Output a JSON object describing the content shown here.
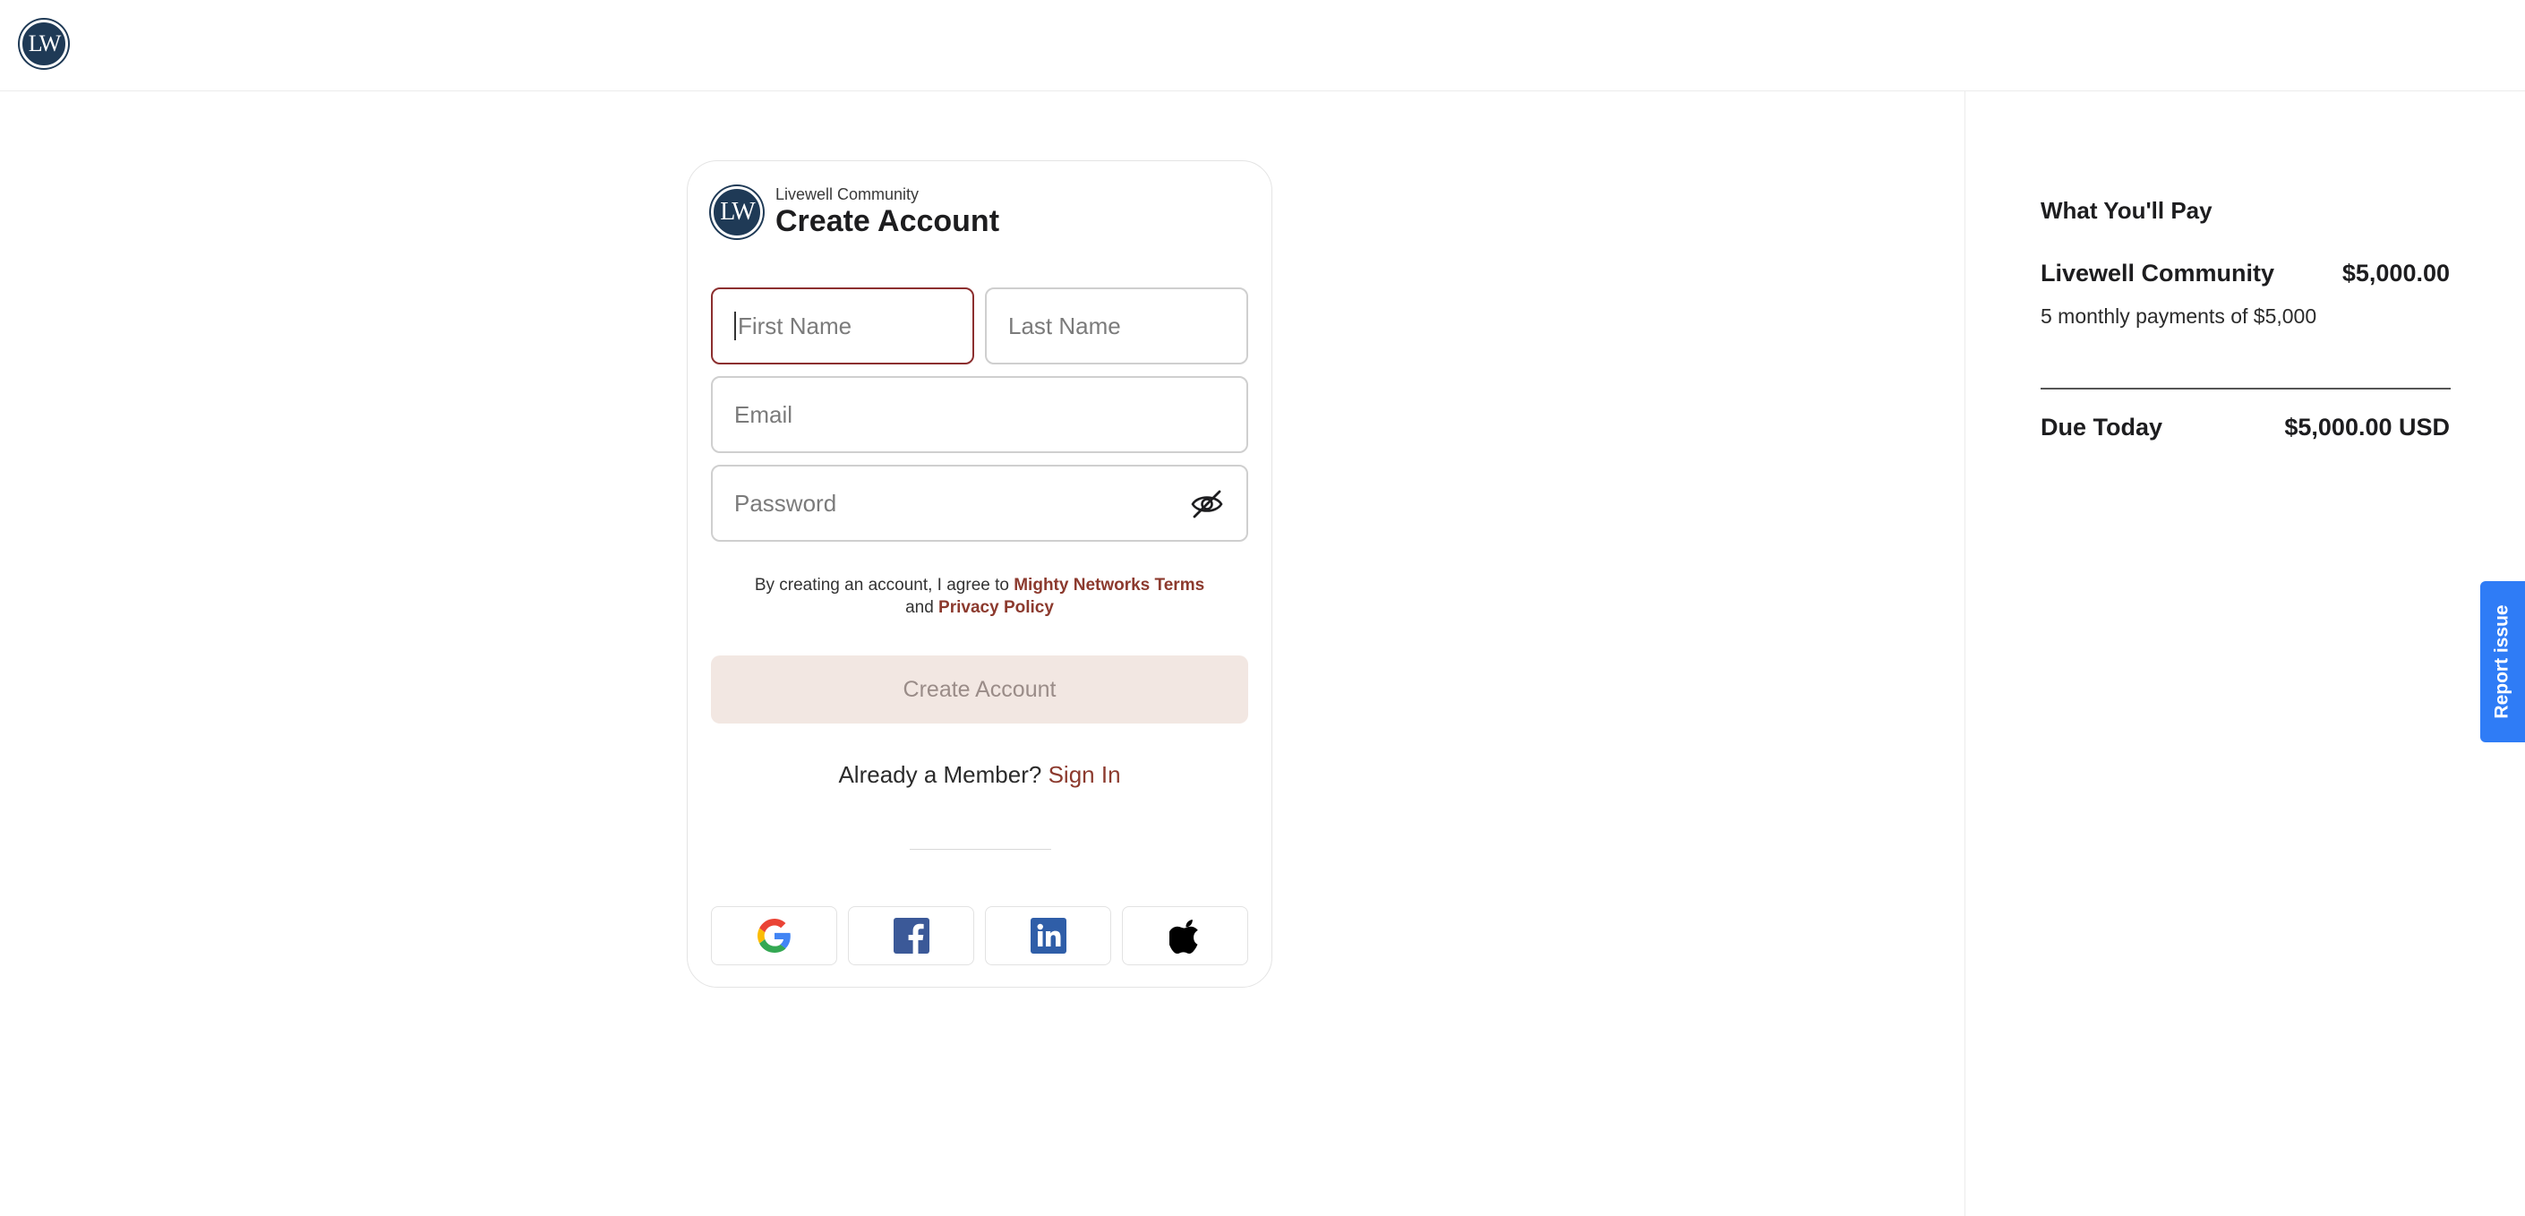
{
  "header": {
    "logo_text": "LW"
  },
  "signup": {
    "logo_text": "LW",
    "community_name": "Livewell Community",
    "title": "Create Account",
    "fields": {
      "first_name_placeholder": "First Name",
      "last_name_placeholder": "Last Name",
      "email_placeholder": "Email",
      "password_placeholder": "Password"
    },
    "terms": {
      "prefix": "By creating an account, I agree to",
      "terms_link": "Mighty Networks Terms",
      "conjunction": "and",
      "privacy_link": "Privacy Policy"
    },
    "submit_label": "Create Account",
    "member_prompt": "Already a Member?",
    "sign_in_label": "Sign In",
    "social_buttons": [
      "google-icon",
      "facebook-icon",
      "linkedin-icon",
      "apple-icon"
    ]
  },
  "payment": {
    "title": "What You'll Pay",
    "item_name": "Livewell Community",
    "item_amount": "$5,000.00",
    "item_detail": "5 monthly payments of $5,000",
    "due_label": "Due Today",
    "due_amount": "$5,000.00 USD"
  },
  "report_issue_label": "Report issue",
  "colors": {
    "brand_navy": "#1f3a56",
    "accent_link": "#8c3a2e",
    "focus_border": "#8c2f2f",
    "disabled_button_bg": "#f2e7e2",
    "report_button": "#2f7cf6"
  }
}
